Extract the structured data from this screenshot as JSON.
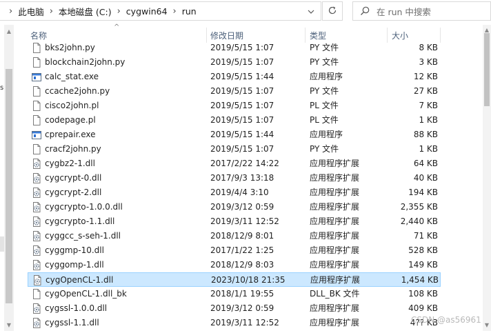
{
  "address_bar": {
    "crumbs": [
      "此电脑",
      "本地磁盘 (C:)",
      "cygwin64",
      "run"
    ],
    "separator": "›",
    "dropdown_icon": "chevron-down-icon",
    "refresh_icon": "refresh-icon"
  },
  "search": {
    "placeholder": "在 run 中搜索",
    "icon": "search-icon"
  },
  "nav_pane": {
    "clipped_text": "s"
  },
  "columns": {
    "name": "名称",
    "date": "修改日期",
    "type": "类型",
    "size": "大小",
    "sort_indicator": "^"
  },
  "files": [
    {
      "name": "bks2john.py",
      "date": "2019/5/15 1:07",
      "type": "PY 文件",
      "size": "8 KB",
      "icon": "document-icon"
    },
    {
      "name": "blockchain2john.py",
      "date": "2019/5/15 1:07",
      "type": "PY 文件",
      "size": "3 KB",
      "icon": "document-icon"
    },
    {
      "name": "calc_stat.exe",
      "date": "2019/5/15 1:44",
      "type": "应用程序",
      "size": "12 KB",
      "icon": "application-icon"
    },
    {
      "name": "ccache2john.py",
      "date": "2019/5/15 1:07",
      "type": "PY 文件",
      "size": "27 KB",
      "icon": "document-icon"
    },
    {
      "name": "cisco2john.pl",
      "date": "2019/5/15 1:07",
      "type": "PL 文件",
      "size": "7 KB",
      "icon": "document-icon"
    },
    {
      "name": "codepage.pl",
      "date": "2019/5/15 1:07",
      "type": "PL 文件",
      "size": "1 KB",
      "icon": "document-icon"
    },
    {
      "name": "cprepair.exe",
      "date": "2019/5/15 1:44",
      "type": "应用程序",
      "size": "88 KB",
      "icon": "application-icon"
    },
    {
      "name": "cracf2john.py",
      "date": "2019/5/15 1:07",
      "type": "PY 文件",
      "size": "1 KB",
      "icon": "document-icon"
    },
    {
      "name": "cygbz2-1.dll",
      "date": "2017/2/22 14:22",
      "type": "应用程序扩展",
      "size": "64 KB",
      "icon": "dll-gear-icon"
    },
    {
      "name": "cygcrypt-0.dll",
      "date": "2017/9/3 13:18",
      "type": "应用程序扩展",
      "size": "40 KB",
      "icon": "dll-gear-icon"
    },
    {
      "name": "cygcrypt-2.dll",
      "date": "2019/4/4 3:10",
      "type": "应用程序扩展",
      "size": "194 KB",
      "icon": "dll-gear-icon"
    },
    {
      "name": "cygcrypto-1.0.0.dll",
      "date": "2019/3/12 0:59",
      "type": "应用程序扩展",
      "size": "2,355 KB",
      "icon": "dll-gear-icon"
    },
    {
      "name": "cygcrypto-1.1.dll",
      "date": "2019/3/11 12:52",
      "type": "应用程序扩展",
      "size": "2,440 KB",
      "icon": "dll-gear-icon"
    },
    {
      "name": "cyggcc_s-seh-1.dll",
      "date": "2018/12/9 8:01",
      "type": "应用程序扩展",
      "size": "71 KB",
      "icon": "dll-gear-icon"
    },
    {
      "name": "cyggmp-10.dll",
      "date": "2017/1/22 1:25",
      "type": "应用程序扩展",
      "size": "528 KB",
      "icon": "dll-gear-icon"
    },
    {
      "name": "cyggomp-1.dll",
      "date": "2018/12/9 8:03",
      "type": "应用程序扩展",
      "size": "149 KB",
      "icon": "dll-gear-icon"
    },
    {
      "name": "cygOpenCL-1.dll",
      "date": "2023/10/18 21:35",
      "type": "应用程序扩展",
      "size": "1,454 KB",
      "icon": "dll-gear-icon",
      "selected": true
    },
    {
      "name": "cygOpenCL-1.dll_bk",
      "date": "2018/1/1 19:55",
      "type": "DLL_BK 文件",
      "size": "108 KB",
      "icon": "document-icon"
    },
    {
      "name": "cygssl-1.0.0.dll",
      "date": "2019/3/12 0:59",
      "type": "应用程序扩展",
      "size": "409 KB",
      "icon": "dll-gear-icon"
    },
    {
      "name": "cygssl-1.1.dll",
      "date": "2019/3/11 12:52",
      "type": "应用程序扩展",
      "size": "4?? KB",
      "icon": "dll-gear-icon"
    }
  ],
  "colors": {
    "selection_fill": "#cce8ff",
    "selection_border": "#99d1ff",
    "header_text": "#4c607a"
  },
  "watermark": "CSDN @as56961"
}
